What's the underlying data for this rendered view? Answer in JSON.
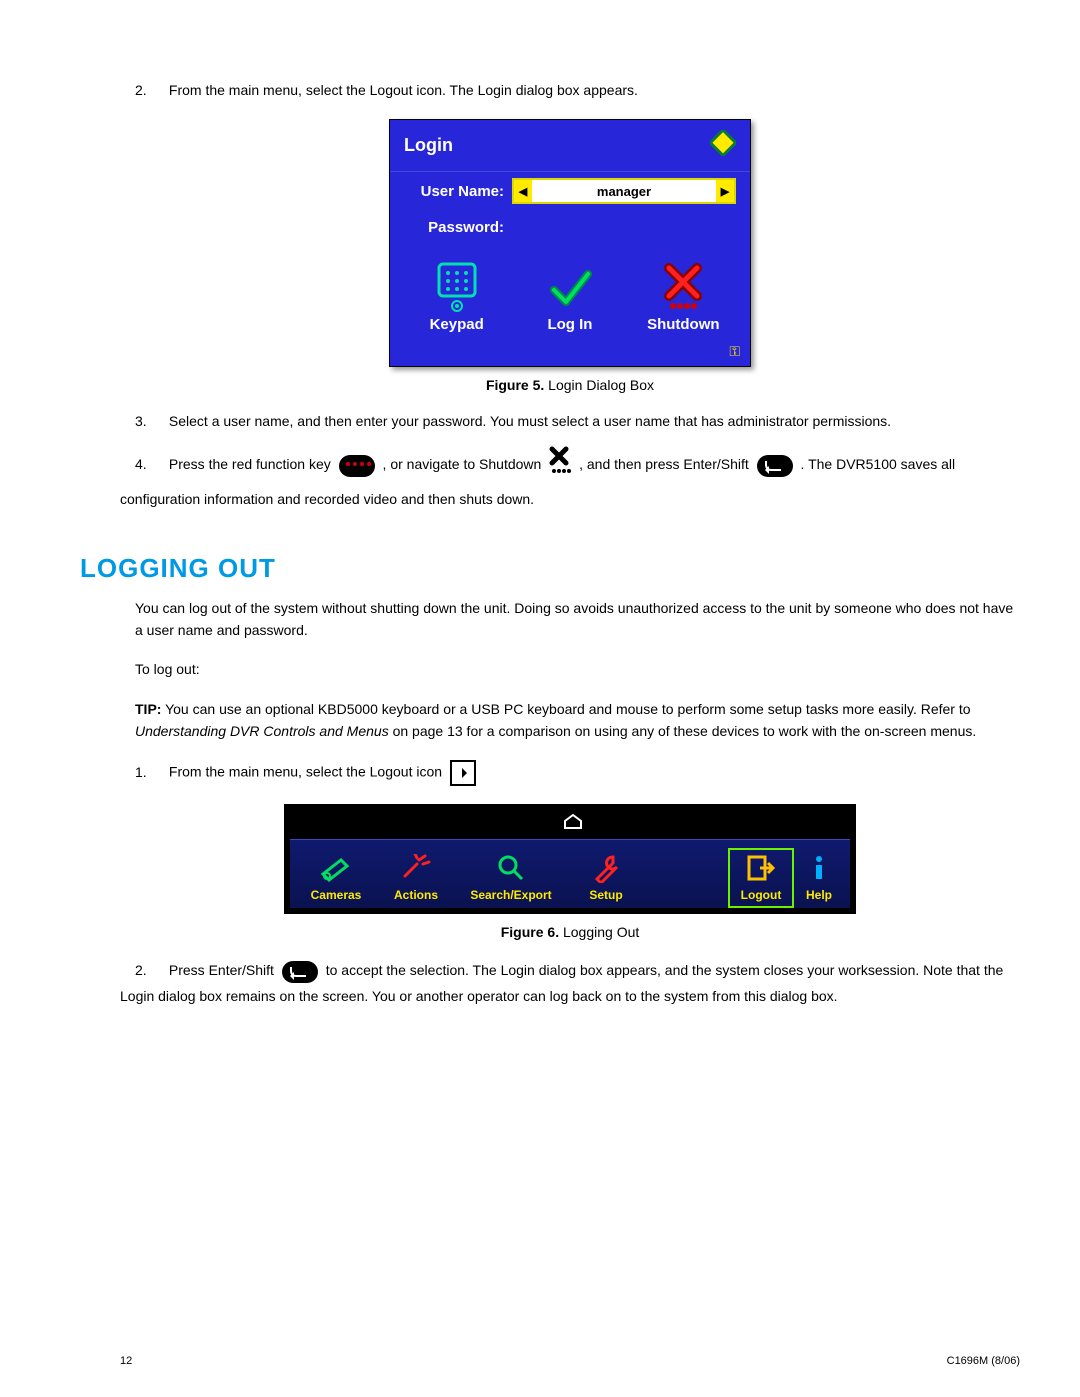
{
  "steps_top": {
    "s2_num": "2.",
    "s2_text": "From the main menu, select the Logout icon. The Login dialog box appears.",
    "s3_num": "3.",
    "s3_text": "Select a user name, and then enter your password. You must select a user name that has administrator permissions.",
    "s4_num": "4.",
    "s4_a": "Press the red function key ",
    "s4_b": " , or navigate to Shutdown ",
    "s4_c": " , and then press Enter/Shift ",
    "s4_d": " . The DVR5100 saves all configuration information and recorded video and then shuts down."
  },
  "figure5": {
    "caption_b": "Figure 5.",
    "caption_t": "  Login Dialog Box",
    "title": "Login",
    "username_label": "User Name:",
    "username_value": "manager",
    "password_label": "Password:",
    "btn_keypad": "Keypad",
    "btn_login": "Log In",
    "btn_shutdown": "Shutdown"
  },
  "section_heading": "LOGGING OUT",
  "logout_intro": "You can log out of the system without shutting down the unit. Doing so avoids unauthorized access to the unit by someone who does not have a user name and password.",
  "to_logout": "To log out:",
  "tip_b": "TIP:",
  "tip_1": " You can use an optional KBD5000 keyboard or a USB PC keyboard and mouse to perform some setup tasks more easily. Refer to ",
  "tip_i": "Understanding DVR Controls and Menus",
  "tip_2": " on page 13 for a comparison on using any of these devices to work with the on-screen menus.",
  "steps_logout": {
    "s1_num": "1.",
    "s1_text": "From the main menu, select the Logout icon ",
    "s2_num": "2.",
    "s2_a": "Press Enter/Shift ",
    "s2_b": " to accept the selection. The Login dialog box appears, and the system closes your worksession. Note that the Login dialog box remains on the screen. You or another operator can log back on to the system from this dialog box."
  },
  "figure6": {
    "caption_b": "Figure 6.",
    "caption_t": "  Logging Out",
    "items": {
      "cameras": "Cameras",
      "actions": "Actions",
      "search": "Search/Export",
      "setup": "Setup",
      "logout": "Logout",
      "help": "Help"
    }
  },
  "footer": {
    "page": "12",
    "doc": "C1696M (8/06)"
  }
}
